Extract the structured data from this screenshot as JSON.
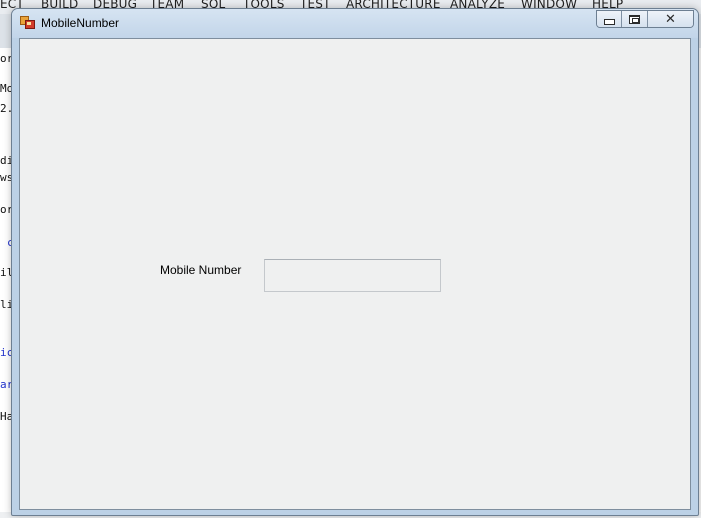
{
  "background_ide": {
    "menu": [
      "ECT",
      "BUILD",
      "DEBUG",
      "TEAM",
      "SQL",
      "TOOLS",
      "TEST",
      "ARCHITECTURE",
      "ANALYZE",
      "WINDOW",
      "HELP"
    ],
    "code_fragments": [
      "orr",
      "Mo",
      "2.",
      "di",
      "ws",
      "or",
      "c",
      "il",
      "li",
      "ic",
      "ar",
      "Ha"
    ]
  },
  "window": {
    "title": "MobileNumber",
    "icon": "winforms-app-icon",
    "caption_buttons": {
      "minimize_icon": "minimize-icon",
      "maximize_icon": "maximize-icon",
      "close_icon": "close-icon"
    }
  },
  "form": {
    "mobile_label": "Mobile Number",
    "mobile_value": "",
    "mobile_placeholder": ""
  },
  "colors": {
    "titlebar": "#c9dbee",
    "client_bg": "#eff0f0",
    "frame_border": "#6d7f92"
  }
}
